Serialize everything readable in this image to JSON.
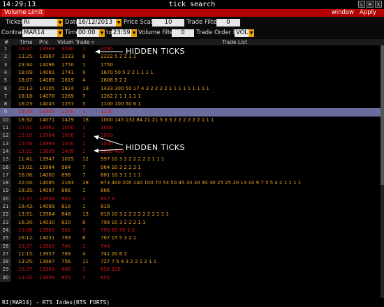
{
  "window": {
    "clock": "14:29:13",
    "title": "tick search",
    "buttons": [
      "L",
      "R",
      "X"
    ]
  },
  "menubar": {
    "tab": "Volume Limit",
    "window_label": "window",
    "apply_label": "Apply"
  },
  "filters": {
    "ticker_label": "Ticker",
    "ticker_value": "RI",
    "date_label": "Date",
    "date_value": "16/12/2013",
    "price_scale_label": "Price Scale",
    "price_scale_value": "10",
    "trade_filter_label": "Trade Filter",
    "trade_filter_value": "0",
    "contract_label": "Contract",
    "contract_value": "MAR14",
    "time_label": "Time",
    "time_from": "00:00",
    "to_label": "to",
    "time_to": "23:59",
    "volume_filter_label": "Volume filter",
    "volume_filter_value": "0",
    "trade_order_label": "Trade Order by",
    "trade_order_value": "VOL"
  },
  "table": {
    "headers": {
      "num": "#",
      "time": "Time",
      "price": "Pric",
      "volume": "Volum",
      "trade": "Trade ▿",
      "list": "Trade List"
    },
    "rows": [
      {
        "n": "1",
        "time": "16:37:",
        "price": "13969",
        "vol": "3290",
        "trade": "1",
        "list": "3290",
        "type": "hidden"
      },
      {
        "n": "2",
        "time": "13:25:",
        "price": "13967",
        "vol": "2233",
        "trade": "6",
        "list": "2222 5 2 2 1 1",
        "type": "normal"
      },
      {
        "n": "3",
        "time": "23:34:",
        "price": "14096",
        "vol": "1750",
        "trade": "1",
        "list": "1750",
        "type": "normal"
      },
      {
        "n": "4",
        "time": "18:09:",
        "price": "14081",
        "vol": "1741",
        "trade": "9",
        "list": "1670 50 5 2 2 1 1 1 1",
        "type": "normal"
      },
      {
        "n": "5",
        "time": "18:07:",
        "price": "14089",
        "vol": "1619",
        "trade": "4",
        "list": "1606 9 2 2",
        "type": "normal"
      },
      {
        "n": "6",
        "time": "20:13:",
        "price": "14105",
        "vol": "1824",
        "trade": "19",
        "list": "1433 300 50 17 4 3 2 2 2 2 1 1 1 1 1 1 1 1 1",
        "type": "normal"
      },
      {
        "n": "7",
        "time": "18:18:",
        "price": "14078",
        "vol": "1269",
        "trade": "7",
        "list": "1262 2 1 1 1 1 1",
        "type": "normal"
      },
      {
        "n": "8",
        "time": "16:23:",
        "price": "14045",
        "vol": "1257",
        "trade": "5",
        "list": "1100 100 50 6 1",
        "type": "normal"
      },
      {
        "n": "9",
        "time": "16:33:",
        "price": "13969",
        "vol": "1200",
        "trade": "1",
        "list": "1200",
        "type": "selected"
      },
      {
        "n": "10",
        "time": "18:32:",
        "price": "14071",
        "vol": "1429",
        "trade": "18",
        "list": "1000 145 132 84 21 21 5 3 3 2 2 2 2 2 2 1 1 1",
        "type": "normal"
      },
      {
        "n": "11",
        "time": "15:31:",
        "price": "13962",
        "vol": "1000",
        "trade": "1",
        "list": "1000",
        "type": "hidden"
      },
      {
        "n": "12",
        "time": "15:10:",
        "price": "13964",
        "vol": "1000",
        "trade": "1",
        "list": "1000",
        "type": "hidden"
      },
      {
        "n": "13",
        "time": "15:09:",
        "price": "13964",
        "vol": "1000",
        "trade": "1",
        "list": "1000",
        "type": "hidden"
      },
      {
        "n": "14",
        "time": "13:31:",
        "price": "13899",
        "vol": "1409",
        "trade": "2",
        "list": "1000 409",
        "type": "hidden"
      },
      {
        "n": "15",
        "time": "11:41:",
        "price": "13947",
        "vol": "1025",
        "trade": "12",
        "list": "997 10 3 2 2 2 2 2 2 1 1 1",
        "type": "normal"
      },
      {
        "n": "16",
        "time": "13:02:",
        "price": "13984",
        "vol": "984",
        "trade": "7",
        "list": "964 10 3 2 2 2 1",
        "type": "normal"
      },
      {
        "n": "17",
        "time": "16:06:",
        "price": "14000",
        "vol": "898",
        "trade": "7",
        "list": "881 10 3 1 1 1 1",
        "type": "normal"
      },
      {
        "n": "18",
        "time": "22:04:",
        "price": "14085",
        "vol": "2183",
        "trade": "28",
        "list": "873 400 200 140 100 70 53 50 45 33 30 30 30 25 25 20 13 10 9 7 5 5 4 2 1 1 1 1",
        "type": "normal"
      },
      {
        "n": "19",
        "time": "18:35:",
        "price": "14097",
        "vol": "866",
        "trade": "1",
        "list": "866",
        "type": "normal"
      },
      {
        "n": "20",
        "time": "15:37:",
        "price": "13964",
        "vol": "860",
        "trade": "2",
        "list": "857 3",
        "type": "hidden"
      },
      {
        "n": "21",
        "time": "18:43:",
        "price": "14099",
        "vol": "818",
        "trade": "1",
        "list": "818",
        "type": "normal"
      },
      {
        "n": "22",
        "time": "13:51:",
        "price": "13964",
        "vol": "848",
        "trade": "13",
        "list": "818 10 3 2 2 2 2 2 2 2 1 1 1",
        "type": "normal"
      },
      {
        "n": "23",
        "time": "16:20:",
        "price": "14030",
        "vol": "820",
        "trade": "8",
        "list": "799 10 3 2 2 2 1 1",
        "type": "normal"
      },
      {
        "n": "24",
        "time": "15:08:",
        "price": "13965",
        "vol": "962",
        "trade": "5",
        "list": "798 50 50 3 3",
        "type": "hidden"
      },
      {
        "n": "25",
        "time": "16:12:",
        "price": "14031",
        "vol": "793",
        "trade": "6",
        "list": "767 15 5 3 2 1",
        "type": "normal"
      },
      {
        "n": "26",
        "time": "16:37:",
        "price": "13969",
        "vol": "746",
        "trade": "1",
        "list": "746",
        "type": "hidden"
      },
      {
        "n": "27",
        "time": "11:15:",
        "price": "13957",
        "vol": "769",
        "trade": "4",
        "list": "741 20 6 2",
        "type": "normal"
      },
      {
        "n": "28",
        "time": "13:25:",
        "price": "13967",
        "vol": "756",
        "trade": "11",
        "list": "727 7 5 4 3 2 2 2 2 1 1",
        "type": "normal"
      },
      {
        "n": "29",
        "time": "16:37:",
        "price": "13969",
        "vol": "866",
        "trade": "2",
        "list": "658 208",
        "type": "hidden"
      },
      {
        "n": "30",
        "time": "13:32:",
        "price": "13899",
        "vol": "655",
        "trade": "1",
        "list": "655",
        "type": "hidden"
      }
    ]
  },
  "annotations": {
    "top": "HIDDEN TICKS",
    "middle": "HIDDEN TICKS"
  },
  "status": {
    "text": "RI(MAR14) - RTS Index(RTS FORTS)"
  },
  "colors": {
    "accent_red": "#b30000",
    "dropdown_orange": "#f0a000",
    "normal_row": "#e8a020",
    "hidden_row": "#d01818",
    "selected_row": "#6b6b9e"
  }
}
